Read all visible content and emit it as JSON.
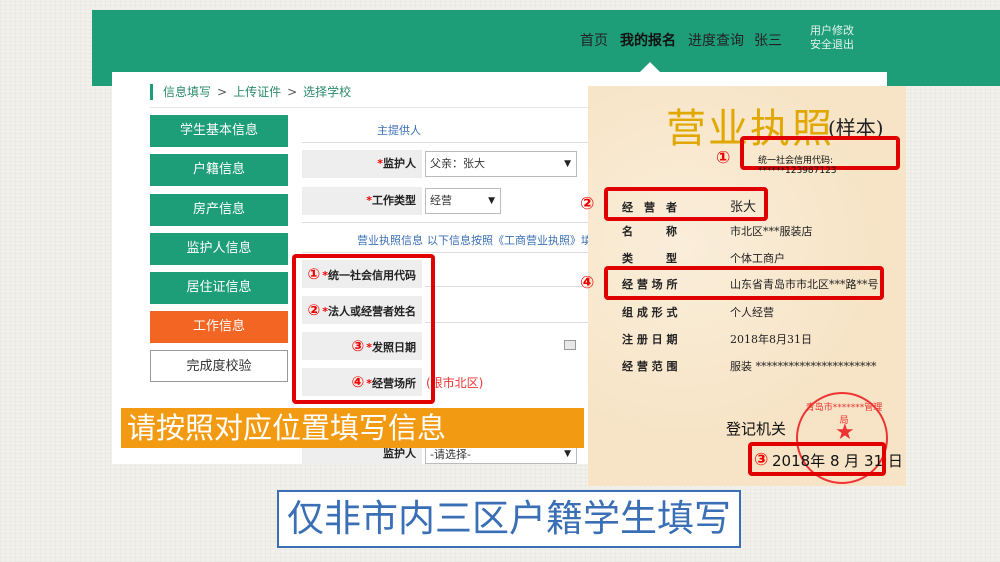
{
  "topnav": {
    "items": [
      "首页",
      "我的报名",
      "进度查询"
    ],
    "user": "张三",
    "user_links": [
      "用户修改",
      "安全退出"
    ]
  },
  "breadcrumb": [
    "信息填写",
    "上传证件",
    "选择学校"
  ],
  "sidebar": [
    {
      "label": "学生基本信息",
      "color": "#1e9e78"
    },
    {
      "label": "户籍信息",
      "color": "#1e9e78"
    },
    {
      "label": "房产信息",
      "color": "#1e9e78"
    },
    {
      "label": "监护人信息",
      "color": "#1e9e78"
    },
    {
      "label": "居住证信息",
      "color": "#1e9e78"
    },
    {
      "label": "工作信息",
      "color": "#f26522"
    },
    {
      "label": "完成度校验",
      "color": "#ffffff"
    }
  ],
  "form": {
    "main_provider_title": "主提供人",
    "guardian_label": "监护人",
    "guardian_value": "父亲：张大",
    "work_type_label": "工作类型",
    "work_type_value": "经营",
    "license_info_title": "营业执照信息",
    "license_info_hint": "以下信息按照《工商营业执照》填写",
    "fields": [
      "统一社会信用代码",
      "法人或经营者姓名",
      "发照日期",
      "经营场所"
    ],
    "field_numbers": [
      "①",
      "②",
      "③",
      "④"
    ],
    "address_hint": "(限市北区)",
    "guardian2_label": "监护人",
    "guardian2_value": "-请选择-"
  },
  "banner": "请按照对应位置填写信息",
  "license": {
    "title": "营业执照",
    "sample": "(样本)",
    "credit_code_label": "统一社会信用代码:",
    "credit_code_value": "******123987123",
    "rows": [
      {
        "key": "经　营　者",
        "value": "张大"
      },
      {
        "key": "名　　　称",
        "value": "市北区***服装店"
      },
      {
        "key": "类　　　型",
        "value": "个体工商户"
      },
      {
        "key": "经 营 场 所",
        "value": "山东省青岛市市北区***路**号"
      },
      {
        "key": "组 成 形 式",
        "value": "个人经营"
      },
      {
        "key": "注 册 日 期",
        "value": "2018年8月31日"
      },
      {
        "key": "经 营 范 围",
        "value": "服装 **********************"
      }
    ],
    "authority": "登记机关",
    "issue_date": "2018年 8 月 31 日",
    "seal_text": "青岛市*******管理局",
    "markers": [
      "①",
      "②",
      "③",
      "④"
    ]
  },
  "caption": "仅非市内三区户籍学生填写",
  "colors": {
    "primary": "#1e9e78",
    "accent": "#f26522",
    "banner": "#f29a12",
    "highlight": "#e10000",
    "caption": "#3a6fb5"
  }
}
